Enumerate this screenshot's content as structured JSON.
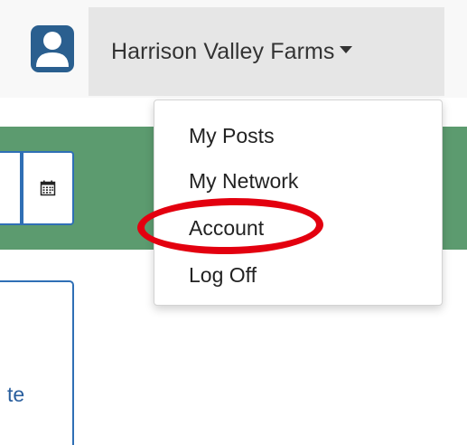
{
  "header": {
    "user_name": "Harrison Valley Farms",
    "avatar_icon": "user-avatar-icon",
    "caret_icon": "caret-down-icon"
  },
  "toolbar": {
    "calendar_icon": "calendar-icon"
  },
  "panel": {
    "partial_text": "te"
  },
  "user_dropdown": {
    "items": [
      {
        "label": "My Posts"
      },
      {
        "label": "My Network"
      },
      {
        "label": "Account"
      },
      {
        "label": "Log Off"
      }
    ]
  },
  "colors": {
    "accent_green": "#5c9b6f",
    "border_blue": "#2f6fb5",
    "avatar_blue": "#2a5f8f",
    "highlight_red": "#e3000f"
  }
}
